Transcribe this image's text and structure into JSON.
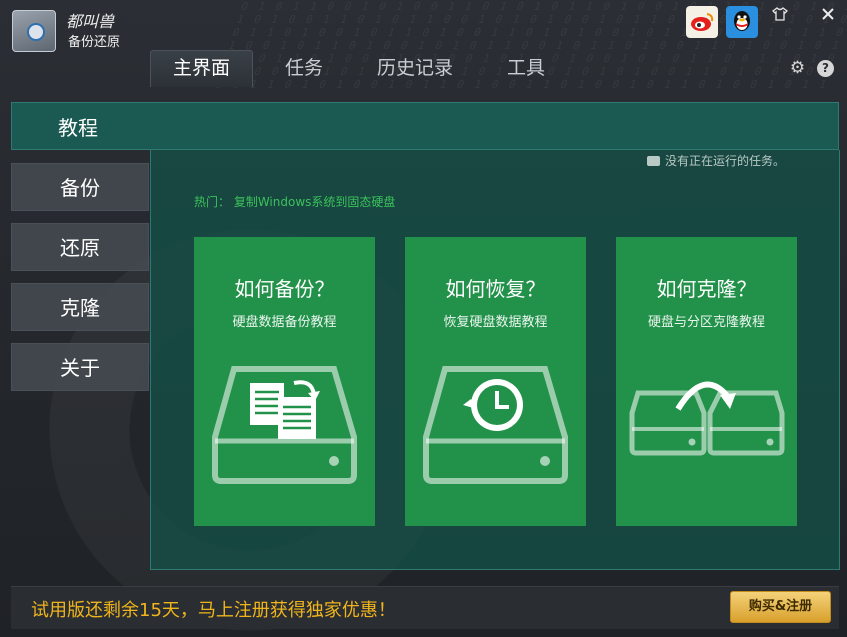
{
  "app": {
    "title_main": "都叫兽",
    "title_sub": "备份还原"
  },
  "titlebar": {
    "weibo_icon": "weibo-icon",
    "qq_icon": "qq-icon",
    "skin_icon": "tshirt-icon",
    "close_icon": "close-icon"
  },
  "tabs": [
    {
      "label": "主界面",
      "active": true
    },
    {
      "label": "任务",
      "active": false
    },
    {
      "label": "历史记录",
      "active": false
    },
    {
      "label": "工具",
      "active": false
    }
  ],
  "sidebar": {
    "items": [
      {
        "label": "教程",
        "active": true
      },
      {
        "label": "备份",
        "active": false
      },
      {
        "label": "还原",
        "active": false
      },
      {
        "label": "克隆",
        "active": false
      },
      {
        "label": "关于",
        "active": false
      }
    ]
  },
  "status": {
    "text": "没有正在运行的任务。"
  },
  "hot": {
    "text": "热门： 复制Windows系统到固态硬盘"
  },
  "cards": [
    {
      "title": "如何备份？",
      "subtitle": "硬盘数据备份教程",
      "icon": "backup-docs-drive-icon"
    },
    {
      "title": "如何恢复？",
      "subtitle": "恢复硬盘数据教程",
      "icon": "restore-clock-drive-icon"
    },
    {
      "title": "如何克隆？",
      "subtitle": "硬盘与分区克隆教程",
      "icon": "clone-drives-icon"
    }
  ],
  "footer": {
    "promo": "试用版还剩余15天，马上注册获得独家优惠！",
    "buy_label": "购买&注册"
  },
  "colors": {
    "accent_green": "#22914a",
    "panel_teal": "#1a5a52",
    "promo_gold": "#f0b51c"
  }
}
